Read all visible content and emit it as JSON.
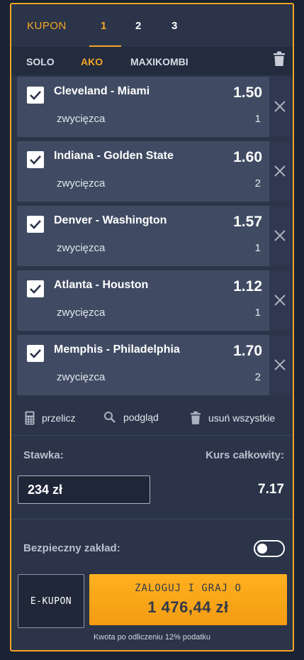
{
  "colors": {
    "accent": "#f5a623",
    "panel": "#2b3449",
    "row": "#404b63",
    "background": "#1a2234"
  },
  "header": {
    "title": "KUPON",
    "tabs": [
      {
        "label": "1",
        "active": true
      },
      {
        "label": "2"
      },
      {
        "label": "3"
      }
    ]
  },
  "bet_types": {
    "solo": "SOLO",
    "ako": "AKO",
    "maxikombi": "MAXIKOMBI",
    "active": "AKO",
    "trash_icon": "trash-icon"
  },
  "bets": [
    {
      "match": "Cleveland - Miami",
      "type": "zwycięzca",
      "odds": "1.50",
      "pick": "1",
      "checked": true
    },
    {
      "match": "Indiana - Golden State",
      "type": "zwycięzca",
      "odds": "1.60",
      "pick": "2",
      "checked": true
    },
    {
      "match": "Denver - Washington",
      "type": "zwycięzca",
      "odds": "1.57",
      "pick": "1",
      "checked": true
    },
    {
      "match": "Atlanta - Houston",
      "type": "zwycięzca",
      "odds": "1.12",
      "pick": "1",
      "checked": true
    },
    {
      "match": "Memphis - Philadelphia",
      "type": "zwycięzca",
      "odds": "1.70",
      "pick": "2",
      "checked": true
    }
  ],
  "tools": {
    "recalc": "przelicz",
    "preview": "podgląd",
    "remove_all": "usuń wszystkie"
  },
  "stake": {
    "label": "Stawka:",
    "value": "234 zł"
  },
  "total_odds": {
    "label": "Kurs całkowity:",
    "value": "7.17"
  },
  "safe_bet": {
    "label": "Bezpieczny zakład:",
    "enabled": false
  },
  "buttons": {
    "ekupon": "E-KUPON",
    "login_line1": "ZALOGUJ I GRAJ O",
    "login_amount": "1 476,44 zł"
  },
  "tax_note": "Kwota po odliczeniu 12% podatku"
}
